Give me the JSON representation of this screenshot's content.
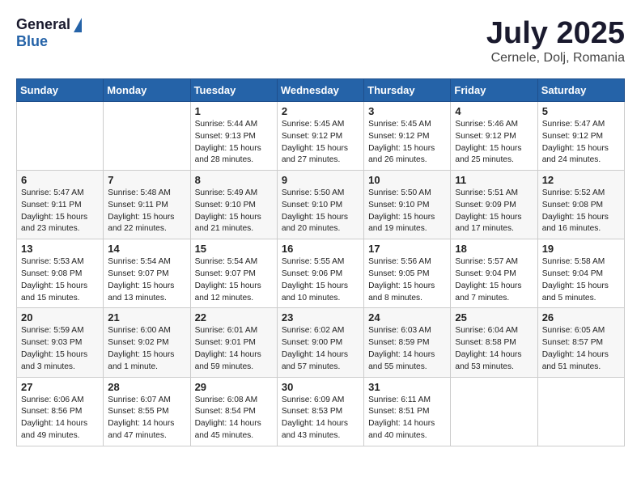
{
  "header": {
    "logo_general": "General",
    "logo_blue": "Blue",
    "title": "July 2025",
    "subtitle": "Cernele, Dolj, Romania"
  },
  "calendar": {
    "days_of_week": [
      "Sunday",
      "Monday",
      "Tuesday",
      "Wednesday",
      "Thursday",
      "Friday",
      "Saturday"
    ],
    "weeks": [
      [
        {
          "day": "",
          "detail": ""
        },
        {
          "day": "",
          "detail": ""
        },
        {
          "day": "1",
          "detail": "Sunrise: 5:44 AM\nSunset: 9:13 PM\nDaylight: 15 hours\nand 28 minutes."
        },
        {
          "day": "2",
          "detail": "Sunrise: 5:45 AM\nSunset: 9:12 PM\nDaylight: 15 hours\nand 27 minutes."
        },
        {
          "day": "3",
          "detail": "Sunrise: 5:45 AM\nSunset: 9:12 PM\nDaylight: 15 hours\nand 26 minutes."
        },
        {
          "day": "4",
          "detail": "Sunrise: 5:46 AM\nSunset: 9:12 PM\nDaylight: 15 hours\nand 25 minutes."
        },
        {
          "day": "5",
          "detail": "Sunrise: 5:47 AM\nSunset: 9:12 PM\nDaylight: 15 hours\nand 24 minutes."
        }
      ],
      [
        {
          "day": "6",
          "detail": "Sunrise: 5:47 AM\nSunset: 9:11 PM\nDaylight: 15 hours\nand 23 minutes."
        },
        {
          "day": "7",
          "detail": "Sunrise: 5:48 AM\nSunset: 9:11 PM\nDaylight: 15 hours\nand 22 minutes."
        },
        {
          "day": "8",
          "detail": "Sunrise: 5:49 AM\nSunset: 9:10 PM\nDaylight: 15 hours\nand 21 minutes."
        },
        {
          "day": "9",
          "detail": "Sunrise: 5:50 AM\nSunset: 9:10 PM\nDaylight: 15 hours\nand 20 minutes."
        },
        {
          "day": "10",
          "detail": "Sunrise: 5:50 AM\nSunset: 9:10 PM\nDaylight: 15 hours\nand 19 minutes."
        },
        {
          "day": "11",
          "detail": "Sunrise: 5:51 AM\nSunset: 9:09 PM\nDaylight: 15 hours\nand 17 minutes."
        },
        {
          "day": "12",
          "detail": "Sunrise: 5:52 AM\nSunset: 9:08 PM\nDaylight: 15 hours\nand 16 minutes."
        }
      ],
      [
        {
          "day": "13",
          "detail": "Sunrise: 5:53 AM\nSunset: 9:08 PM\nDaylight: 15 hours\nand 15 minutes."
        },
        {
          "day": "14",
          "detail": "Sunrise: 5:54 AM\nSunset: 9:07 PM\nDaylight: 15 hours\nand 13 minutes."
        },
        {
          "day": "15",
          "detail": "Sunrise: 5:54 AM\nSunset: 9:07 PM\nDaylight: 15 hours\nand 12 minutes."
        },
        {
          "day": "16",
          "detail": "Sunrise: 5:55 AM\nSunset: 9:06 PM\nDaylight: 15 hours\nand 10 minutes."
        },
        {
          "day": "17",
          "detail": "Sunrise: 5:56 AM\nSunset: 9:05 PM\nDaylight: 15 hours\nand 8 minutes."
        },
        {
          "day": "18",
          "detail": "Sunrise: 5:57 AM\nSunset: 9:04 PM\nDaylight: 15 hours\nand 7 minutes."
        },
        {
          "day": "19",
          "detail": "Sunrise: 5:58 AM\nSunset: 9:04 PM\nDaylight: 15 hours\nand 5 minutes."
        }
      ],
      [
        {
          "day": "20",
          "detail": "Sunrise: 5:59 AM\nSunset: 9:03 PM\nDaylight: 15 hours\nand 3 minutes."
        },
        {
          "day": "21",
          "detail": "Sunrise: 6:00 AM\nSunset: 9:02 PM\nDaylight: 15 hours\nand 1 minute."
        },
        {
          "day": "22",
          "detail": "Sunrise: 6:01 AM\nSunset: 9:01 PM\nDaylight: 14 hours\nand 59 minutes."
        },
        {
          "day": "23",
          "detail": "Sunrise: 6:02 AM\nSunset: 9:00 PM\nDaylight: 14 hours\nand 57 minutes."
        },
        {
          "day": "24",
          "detail": "Sunrise: 6:03 AM\nSunset: 8:59 PM\nDaylight: 14 hours\nand 55 minutes."
        },
        {
          "day": "25",
          "detail": "Sunrise: 6:04 AM\nSunset: 8:58 PM\nDaylight: 14 hours\nand 53 minutes."
        },
        {
          "day": "26",
          "detail": "Sunrise: 6:05 AM\nSunset: 8:57 PM\nDaylight: 14 hours\nand 51 minutes."
        }
      ],
      [
        {
          "day": "27",
          "detail": "Sunrise: 6:06 AM\nSunset: 8:56 PM\nDaylight: 14 hours\nand 49 minutes."
        },
        {
          "day": "28",
          "detail": "Sunrise: 6:07 AM\nSunset: 8:55 PM\nDaylight: 14 hours\nand 47 minutes."
        },
        {
          "day": "29",
          "detail": "Sunrise: 6:08 AM\nSunset: 8:54 PM\nDaylight: 14 hours\nand 45 minutes."
        },
        {
          "day": "30",
          "detail": "Sunrise: 6:09 AM\nSunset: 8:53 PM\nDaylight: 14 hours\nand 43 minutes."
        },
        {
          "day": "31",
          "detail": "Sunrise: 6:11 AM\nSunset: 8:51 PM\nDaylight: 14 hours\nand 40 minutes."
        },
        {
          "day": "",
          "detail": ""
        },
        {
          "day": "",
          "detail": ""
        }
      ]
    ]
  }
}
